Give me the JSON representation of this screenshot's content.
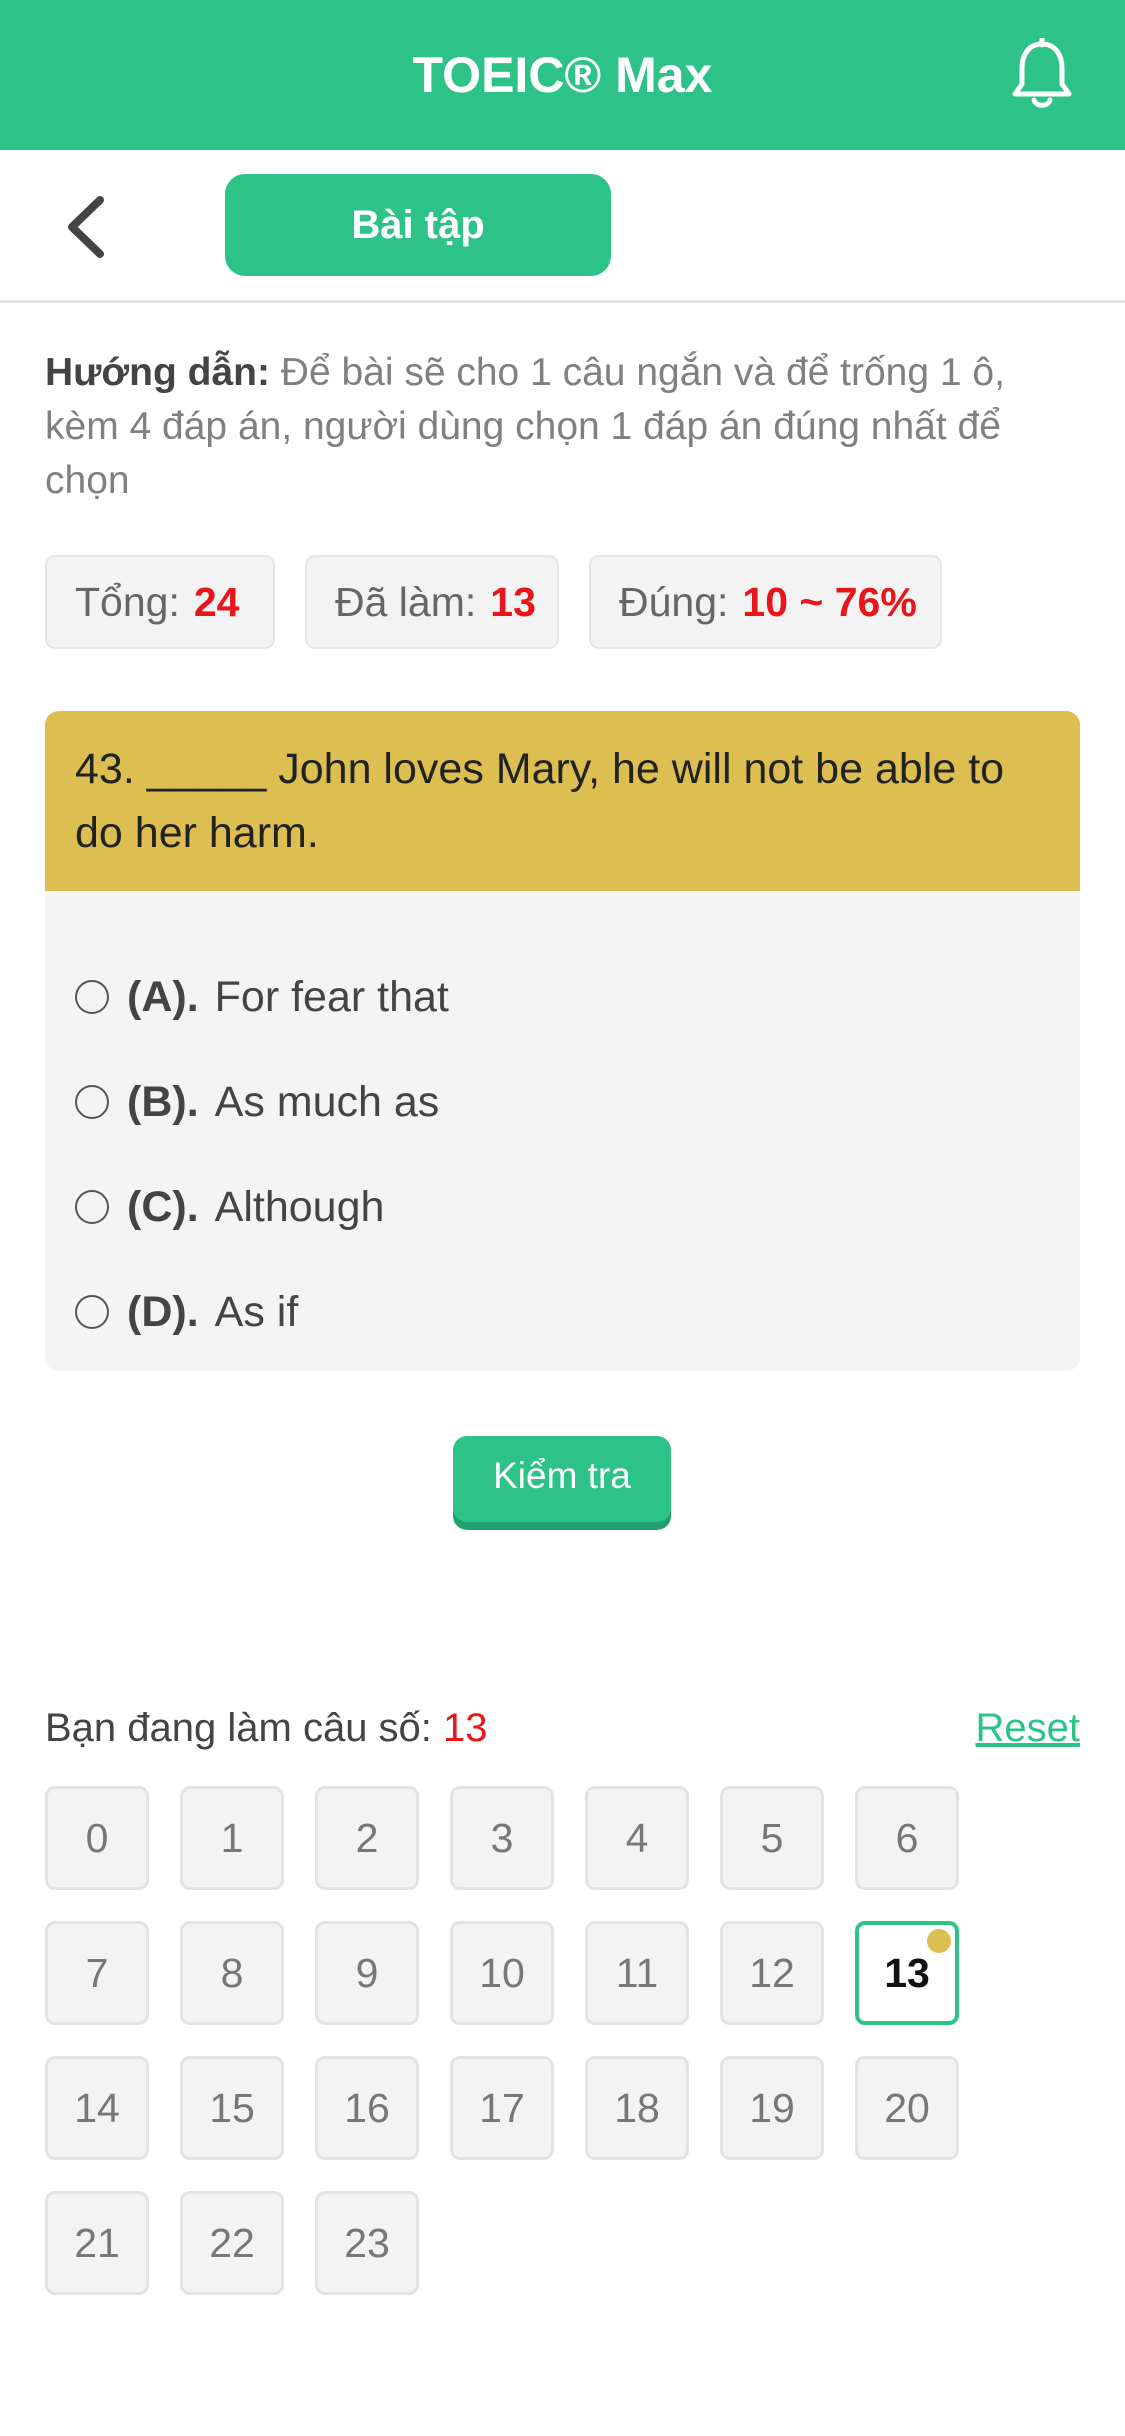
{
  "header": {
    "title": "TOEIC® Max",
    "bell_icon": "bell-icon",
    "color": "#2dc387"
  },
  "subbar": {
    "back_icon": "chevron-left-icon",
    "tab_label": "Bài tập"
  },
  "guide": {
    "label": "Hướng dẫn:",
    "text": " Để bài sẽ cho 1 câu ngắn và để trống 1 ô, kèm 4 đáp án, người dùng chọn 1 đáp án đúng nhất để chọn"
  },
  "stats": {
    "total_label": "Tổng:",
    "total_value": "24",
    "done_label": "Đã làm:",
    "done_value": "13",
    "correct_label": "Đúng:",
    "correct_value": "10 ~ 76%"
  },
  "question": {
    "text": "43. _____ John loves Mary, he will not be able to do her harm.",
    "header_color": "#dcbf50",
    "options": [
      {
        "letter": "(A).",
        "text": "For fear that"
      },
      {
        "letter": "(B).",
        "text": "As much as"
      },
      {
        "letter": "(C).",
        "text": "Although"
      },
      {
        "letter": "(D).",
        "text": "As if"
      }
    ]
  },
  "check_button": "Kiểm tra",
  "navigator": {
    "current_label": "Bạn đang làm câu số:",
    "current_value": "13",
    "reset_label": "Reset",
    "numbers": [
      "0",
      "1",
      "2",
      "3",
      "4",
      "5",
      "6",
      "7",
      "8",
      "9",
      "10",
      "11",
      "12",
      "13",
      "14",
      "15",
      "16",
      "17",
      "18",
      "19",
      "20",
      "21",
      "22",
      "23"
    ],
    "active": "13"
  }
}
